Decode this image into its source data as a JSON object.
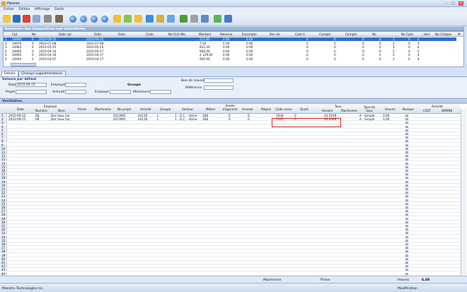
{
  "window": {
    "title": "Heures"
  },
  "menu": [
    "Fichier",
    "Édition",
    "Affichage",
    "Outils"
  ],
  "source": {
    "title": "Sommaire des transactions non transférées",
    "columns": [
      "Cpt",
      "No",
      "Date cpt",
      "Date",
      "Date",
      "Code",
      "No Fact./No",
      "Montant",
      "Retenue",
      "Escompte",
      "Bon de",
      "Cpte à",
      "Compte",
      "Compte",
      "No",
      "No Cpte",
      "...Vers",
      "No Chèque",
      "M"
    ],
    "rows": [
      {
        "cpt": "34980",
        "no": "0",
        "date_cpt": "2010-09-15",
        "date": "2010-09-15",
        "montant": "215.85",
        "retenue": "0.00",
        "escompte": "0.00",
        "c1": "0",
        "c2": "0",
        "c3": "0",
        "n1": "0",
        "n2": "2",
        "n3": "0",
        "vers": "4"
      },
      {
        "cpt": "34976",
        "no": "0",
        "date_cpt": "2010-07-08",
        "date": "2010-07-08",
        "montant": "7.50",
        "retenue": "5.00",
        "escompte": "0.00",
        "c1": "0",
        "c2": "0",
        "c3": "0",
        "n1": "0",
        "n2": "2",
        "n3": "0",
        "vers": "4"
      },
      {
        "cpt": "34963",
        "no": "0",
        "date_cpt": "2010-05-25",
        "date": "2010-05-25",
        "montant": "833.30",
        "retenue": "0.00",
        "escompte": "0.00",
        "c1": "0",
        "c2": "0",
        "c3": "0",
        "n1": "0",
        "n2": "2",
        "n3": "0",
        "vers": "4"
      },
      {
        "cpt": "34946",
        "no": "0",
        "date_cpt": "2010-04-16",
        "date": "2010-04-17",
        "montant": "900.00",
        "retenue": "0.00",
        "escompte": "0.00",
        "c1": "0",
        "c2": "0",
        "c3": "0",
        "n1": "0",
        "n2": "2",
        "n3": "0",
        "vers": "C"
      },
      {
        "cpt": "34945",
        "no": "0",
        "date_cpt": "2010-04-16",
        "date": "2010-04-17",
        "montant": "2 129.60",
        "retenue": "0.00",
        "escompte": "0.00",
        "c1": "0",
        "c2": "0",
        "c3": "0",
        "n1": "0",
        "n2": "2",
        "n3": "0",
        "vers": "4"
      },
      {
        "cpt": "34944",
        "no": "0",
        "date_cpt": "2010-04-07",
        "date": "2010-04-17",
        "montant": "900.00",
        "retenue": "0.00",
        "escompte": "0.00",
        "c1": "0",
        "c2": "0",
        "c3": "0",
        "n1": "0",
        "n2": "2",
        "n3": "0",
        "vers": "4"
      }
    ]
  },
  "tabs": [
    "Détails",
    "Champs supplémentaires"
  ],
  "defaults": {
    "title": "Valeurs par défaut",
    "date_label": "Date",
    "date_value": "2010-09-15",
    "employe_label": "Employé",
    "projet_label": "Projet",
    "activite_label": "Activité",
    "groupe_label": "Groupe",
    "employe2_label": "Employé",
    "machinerie_label": "Machinerie",
    "bon_label": "Bon de travail",
    "reference_label": "Référence"
  },
  "ventilation": {
    "title": "Ventilation",
    "columns": [
      "Date",
      "Employé",
      "Numéro",
      "Nom",
      "Prime",
      "Machinerie",
      "No projet",
      "Activité",
      "Groupe",
      "Secteur",
      "Métier",
      "Année d'apprenti",
      "Annexe",
      "Région",
      "Code union",
      "Quart",
      "Taux",
      "Horaire",
      "Machinerie",
      "Type de taux",
      "Heures",
      "Banque",
      "Activité",
      "CSST",
      "DMSRB"
    ],
    "rows": [
      {
        "n": "1",
        "date": "2010-09-15",
        "num": "68",
        "nom": "Des taux hor",
        "proj": "01CAM1",
        "act": "44116",
        "grp": "L",
        "sect": "1 - G.C. - Voirie",
        "metier": "168",
        "annee": "0",
        "annexe": "0",
        "code": "1934",
        "quart": "0",
        "horaire": "33.0169",
        "type": "A - Simple",
        "heures": "3.00"
      },
      {
        "n": "2",
        "date": "2010-09-15",
        "num": "68",
        "nom": "Des taux hor",
        "proj": "01CAM1",
        "act": "44116",
        "grp": "L",
        "sect": "1 - G.C. - Voirie",
        "metier": "168",
        "annee": "0",
        "annexe": "0",
        "code": "1935",
        "quart": "0",
        "horaire": "36.0069",
        "type": "A - Simple",
        "heures": "3.00"
      }
    ],
    "total_rows": 44
  },
  "footer": {
    "machinerie": "Machinerie",
    "prime": "Prime",
    "heures": "Heures",
    "heures_value": "6,00"
  },
  "status": {
    "company": "Maestro Technologies inc.",
    "mode": "Modification"
  }
}
